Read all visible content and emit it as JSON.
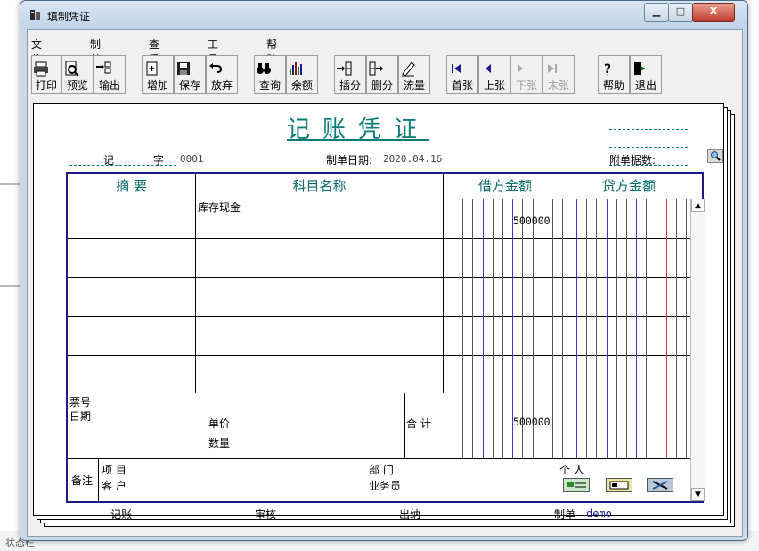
{
  "window": {
    "title": "填制凭证",
    "min": "▁",
    "max": "□",
    "close": "X"
  },
  "menu": [
    "文件(F)",
    "制单(E)",
    "查看(V)",
    "工具(T)",
    "帮助(H)"
  ],
  "toolbar": [
    {
      "label": "打印",
      "icon": "printer-icon",
      "enabled": true
    },
    {
      "label": "预览",
      "icon": "preview-icon",
      "enabled": true
    },
    {
      "label": "输出",
      "icon": "export-icon",
      "enabled": true
    },
    {
      "label": "增加",
      "icon": "add-icon",
      "enabled": true
    },
    {
      "label": "保存",
      "icon": "save-icon",
      "enabled": true
    },
    {
      "label": "放弃",
      "icon": "undo-icon",
      "enabled": true
    },
    {
      "label": "查询",
      "icon": "binoculars-icon",
      "enabled": true
    },
    {
      "label": "余额",
      "icon": "bar-chart-icon",
      "enabled": true
    },
    {
      "label": "插分",
      "icon": "insert-row-icon",
      "enabled": true
    },
    {
      "label": "删分",
      "icon": "delete-row-icon",
      "enabled": true
    },
    {
      "label": "流量",
      "icon": "flow-icon",
      "enabled": true
    },
    {
      "label": "首张",
      "icon": "first-icon",
      "enabled": true
    },
    {
      "label": "上张",
      "icon": "prev-icon",
      "enabled": true
    },
    {
      "label": "下张",
      "icon": "next-icon",
      "enabled": false
    },
    {
      "label": "末张",
      "icon": "last-icon",
      "enabled": false
    },
    {
      "label": "帮助",
      "icon": "help-icon",
      "enabled": true
    },
    {
      "label": "退出",
      "icon": "exit-icon",
      "enabled": true
    }
  ],
  "voucher": {
    "title": "记账凭证",
    "type_label": "记",
    "zi": "字",
    "number": "0001",
    "date_label": "制单日期:",
    "date": "2020.04.16",
    "attachments_label": "附单据数:",
    "columns": [
      "摘 要",
      "科目名称",
      "借方金额",
      "贷方金额"
    ],
    "rows": [
      {
        "summary": "",
        "account": "库存现金",
        "debit": "500000",
        "credit": ""
      },
      {
        "summary": "",
        "account": "",
        "debit": "",
        "credit": ""
      },
      {
        "summary": "",
        "account": "",
        "debit": "",
        "credit": ""
      },
      {
        "summary": "",
        "account": "",
        "debit": "",
        "credit": ""
      },
      {
        "summary": "",
        "account": "",
        "debit": "",
        "credit": ""
      }
    ],
    "ticket_label": "票号",
    "date_row_label": "日期",
    "unit_price_label": "单价",
    "quantity_label": "数量",
    "total_label": "合 计",
    "total_debit": "500000",
    "remark_label": "备注",
    "project_label": "项 目",
    "customer_label": "客 户",
    "dept_label": "部 门",
    "person_label": "个 人",
    "salesman_label": "业务员"
  },
  "footer": {
    "bookkeeping": "记账",
    "audit": "审核",
    "cashier": "出纳",
    "maker": "制单",
    "maker_name": "demo"
  },
  "bottom_text": "状态栏"
}
